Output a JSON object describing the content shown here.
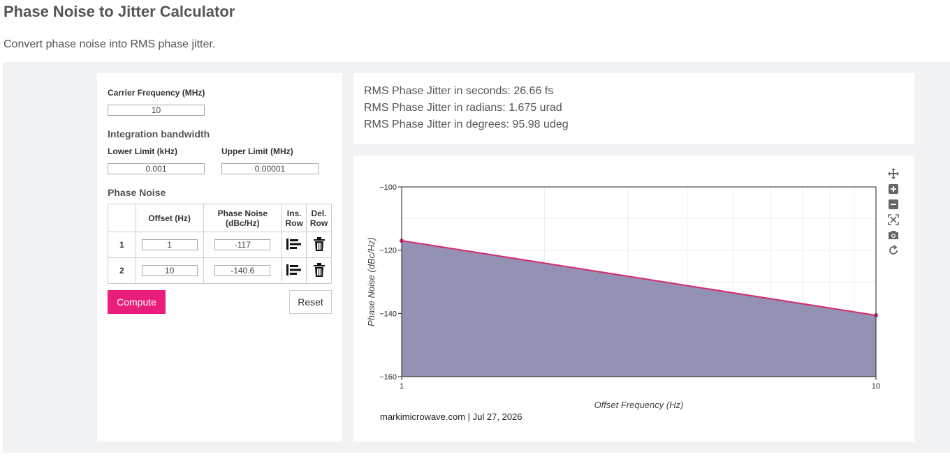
{
  "header": {
    "title": "Phase Noise to Jitter Calculator",
    "subtitle": "Convert phase noise into RMS phase jitter."
  },
  "inputs": {
    "carrier_label": "Carrier Frequency (MHz)",
    "carrier_value": "10",
    "bandwidth_heading": "Integration bandwidth",
    "lower_label": "Lower Limit (kHz)",
    "lower_value": "0.001",
    "upper_label": "Upper Limit (MHz)",
    "upper_value": "0.00001",
    "phase_noise_heading": "Phase Noise"
  },
  "table": {
    "headers": {
      "offset": "Offset (Hz)",
      "phase_noise_line1": "Phase Noise",
      "phase_noise_line2": "(dBc/Hz)",
      "ins_line1": "Ins.",
      "ins_line2": "Row",
      "del_line1": "Del.",
      "del_line2": "Row"
    },
    "rows": [
      {
        "num": "1",
        "offset": "1",
        "noise": "-117"
      },
      {
        "num": "2",
        "offset": "10",
        "noise": "-140.6"
      }
    ]
  },
  "buttons": {
    "compute": "Compute",
    "reset": "Reset"
  },
  "results": {
    "seconds": "RMS Phase Jitter in seconds: 26.66 fs",
    "radians": "RMS Phase Jitter in radians: 1.675 urad",
    "degrees": "RMS Phase Jitter in degrees: 95.98 udeg"
  },
  "colors": {
    "accent": "#e91e7a",
    "line": "#d6296f",
    "fill": "#9392b5"
  },
  "modebar_icons": [
    "pan-icon",
    "zoom-in-icon",
    "zoom-out-icon",
    "autoscale-icon",
    "camera-icon",
    "reset-axes-icon"
  ],
  "chart_data": {
    "type": "area",
    "x_scale": "log",
    "x": [
      1,
      10
    ],
    "y": [
      -117,
      -140.6
    ],
    "xlim": [
      1,
      10
    ],
    "ylim": [
      -160,
      -100
    ],
    "xlabel": "Offset Frequency (Hz)",
    "ylabel": "Phase Noise (dBc/Hz)",
    "xticks": [
      1,
      10
    ],
    "xtick_labels": [
      "1",
      "10"
    ],
    "yticks": [
      -100,
      -120,
      -140,
      -160
    ],
    "ytick_labels": [
      "−100",
      "−120",
      "−140",
      "−160"
    ],
    "grid": true,
    "watermark": "markimicrowave.com | Jul 27, 2026"
  }
}
